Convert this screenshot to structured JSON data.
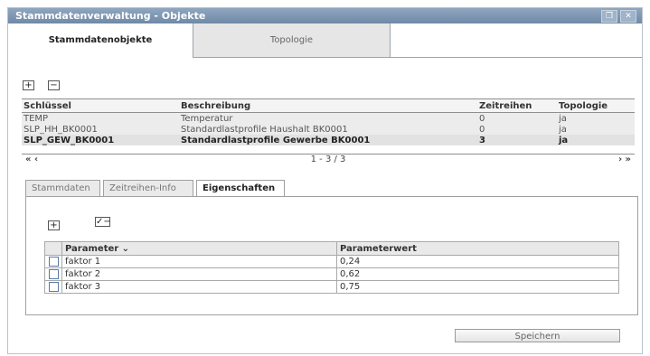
{
  "window": {
    "title": "Stammdatenverwaltung - Objekte",
    "controls": [
      "restore-icon",
      "close-icon"
    ]
  },
  "main_tabs": [
    {
      "label": "Stammdatenobjekte",
      "active": true
    },
    {
      "label": "Topologie",
      "active": false
    }
  ],
  "toolbar": {
    "add_label": "+",
    "remove_label": "−"
  },
  "objects_table": {
    "columns": [
      "Schlüssel",
      "Beschreibung",
      "Zeitreihen",
      "Topologie"
    ],
    "rows": [
      {
        "key": "TEMP",
        "description": "Temperatur",
        "zeitreihen": "0",
        "topologie": "ja"
      },
      {
        "key": "SLP_HH_BK0001",
        "description": "Standardlastprofile Haushalt BK0001",
        "zeitreihen": "0",
        "topologie": "ja"
      },
      {
        "key": "SLP_GEW_BK0001",
        "description": "Standardlastprofile Gewerbe BK0001",
        "zeitreihen": "3",
        "topologie": "ja",
        "selected": true
      }
    ]
  },
  "pager": {
    "first_prev": "« ‹",
    "info": "1 - 3 / 3",
    "next_last": "› »"
  },
  "sub_tabs": [
    {
      "label": "Stammdaten",
      "active": false
    },
    {
      "label": "Zeitreihen-Info",
      "active": false
    },
    {
      "label": "Eigenschaften",
      "active": true
    }
  ],
  "param_toolbar": {
    "add_label": "+",
    "edit_label": "✓−"
  },
  "params_table": {
    "columns": [
      "Parameter",
      "Parameterwert"
    ],
    "sort_icon": "chevron-down-icon",
    "rows": [
      {
        "name": "faktor 1",
        "value": "0,24"
      },
      {
        "name": "faktor 2",
        "value": "0,62"
      },
      {
        "name": "faktor 3",
        "value": "0,75"
      }
    ]
  },
  "save_label": "Speichern"
}
